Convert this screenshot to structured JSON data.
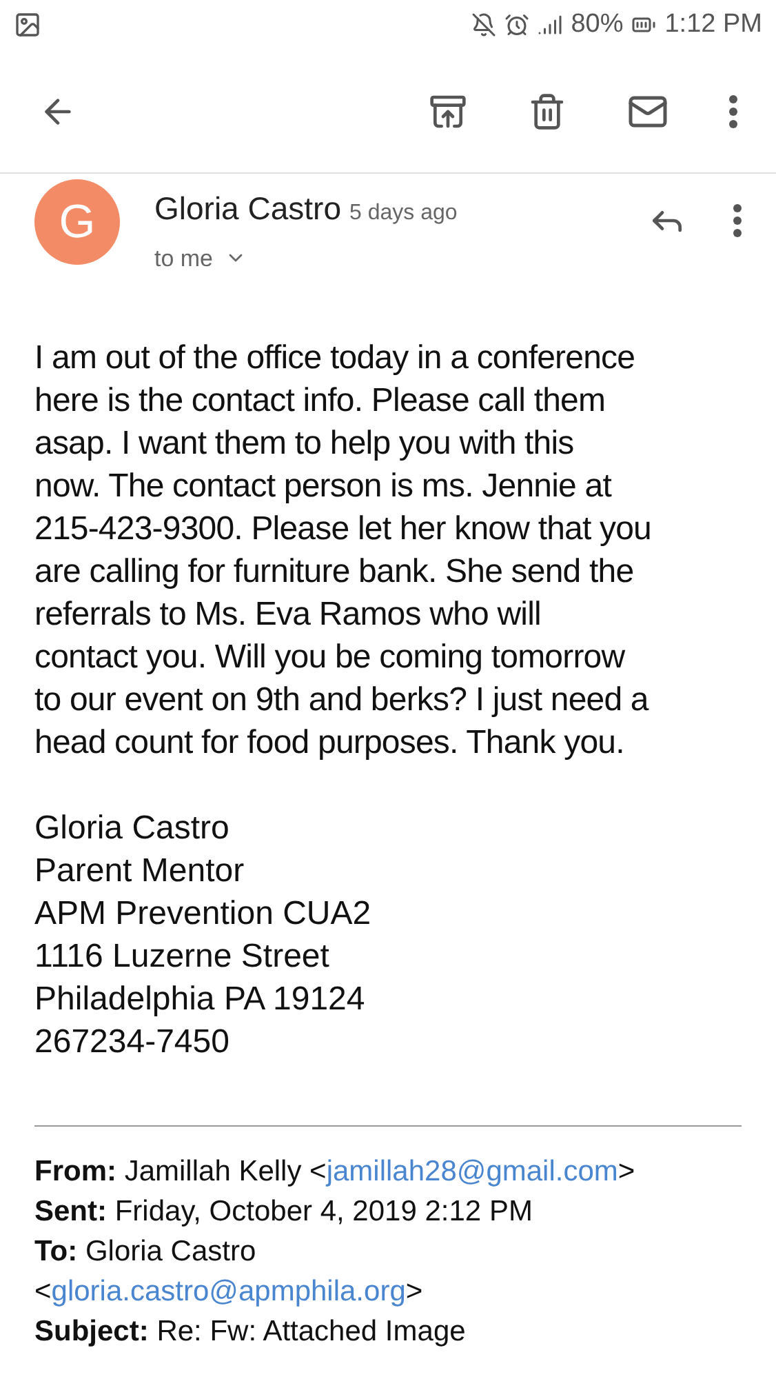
{
  "status_bar": {
    "battery": "80%",
    "time": "1:12 PM"
  },
  "message": {
    "avatar_letter": "G",
    "sender": "Gloria Castro",
    "time": "5 days ago",
    "recipient": "to me"
  },
  "body_lines": [
    "I am out of the office today in a conference",
    "here is the contact info. Please call them",
    "asap. I want them to help you with this",
    "now. The contact person is ms. Jennie at",
    "215-423-9300. Please let her know that you",
    "are calling for furniture bank. She send the",
    "referrals to Ms. Eva Ramos who will",
    "contact you. Will you be coming tomorrow",
    "to our event on 9th and berks? I just need a",
    "head count for food purposes. Thank you."
  ],
  "signature_lines": [
    "Gloria Castro",
    "Parent Mentor",
    "APM Prevention CUA2",
    "1116 Luzerne Street",
    "Philadelphia PA 19124",
    "267234-7450"
  ],
  "quoted_header": [
    {
      "label": "From:",
      "text": "Jamillah Kelly <",
      "link": "jamillah28@gmail.com",
      "after": ">"
    },
    {
      "label": "Sent:",
      "text": "Friday, October 4, 2019 2:12 PM"
    },
    {
      "label": "To:",
      "text": "Gloria Castro"
    },
    {
      "text": "<",
      "link": "gloria.castro@apmphila.org",
      "after": ">"
    },
    {
      "label": "Subject:",
      "text": "Re: Fw: Attached Image"
    }
  ]
}
